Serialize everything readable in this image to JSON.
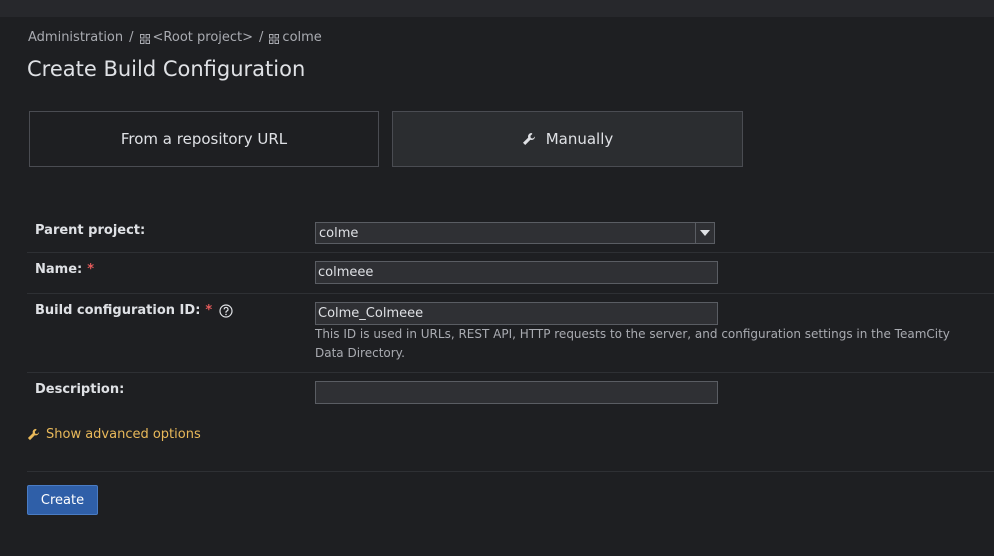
{
  "breadcrumb": {
    "items": [
      "Administration",
      "<Root project>",
      "colme"
    ],
    "separator": "/"
  },
  "page": {
    "title": "Create Build Configuration"
  },
  "modes": {
    "repo_label": "From a repository URL",
    "manual_label": "Manually"
  },
  "form": {
    "parent_project": {
      "label": "Parent project:",
      "value": "colme"
    },
    "name": {
      "label": "Name:",
      "required_mark": "*",
      "value": "colmeee"
    },
    "build_id": {
      "label": "Build configuration ID:",
      "required_mark": "*",
      "value": "Colme_Colmeee",
      "hint": "This ID is used in URLs, REST API, HTTP requests to the server, and configuration settings in the TeamCity Data Directory."
    },
    "description": {
      "label": "Description:",
      "value": ""
    }
  },
  "advanced_options_label": "Show advanced options",
  "create_button_label": "Create",
  "colors": {
    "background": "#1e1f22",
    "accent_link": "#e9b95a",
    "primary_button": "#2f5fa8",
    "required": "#e55b5b"
  }
}
